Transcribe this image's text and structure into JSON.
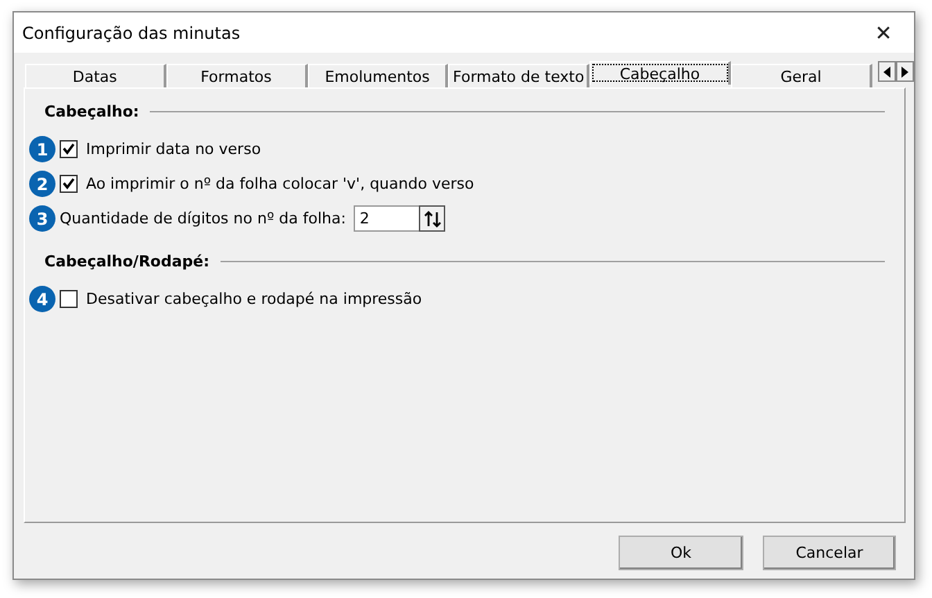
{
  "window": {
    "title": "Configuração das minutas",
    "close": "✕"
  },
  "tabs": [
    {
      "label": "Datas",
      "selected": false
    },
    {
      "label": "Formatos",
      "selected": false
    },
    {
      "label": "Emolumentos",
      "selected": false
    },
    {
      "label": "Formato de texto",
      "selected": false
    },
    {
      "label": "Cabeçalho",
      "selected": true
    },
    {
      "label": "Geral",
      "selected": false
    }
  ],
  "sections": [
    {
      "heading": "Cabeçalho:",
      "items": [
        {
          "kind": "checkbox",
          "badge": "1",
          "label": "Imprimir data no verso",
          "checked": true
        },
        {
          "kind": "checkbox",
          "badge": "2",
          "label": "Ao imprimir o nº da folha colocar 'v', quando verso",
          "checked": true
        },
        {
          "kind": "spin",
          "badge": "3",
          "label": "Quantidade de dígitos no nº da folha:",
          "value": "2"
        }
      ]
    },
    {
      "heading": "Cabeçalho/Rodapé:",
      "items": [
        {
          "kind": "checkbox",
          "badge": "4",
          "label": "Desativar cabeçalho e rodapé na impressão",
          "checked": false
        }
      ]
    }
  ],
  "buttons": [
    "Ok",
    "Cancelar"
  ]
}
